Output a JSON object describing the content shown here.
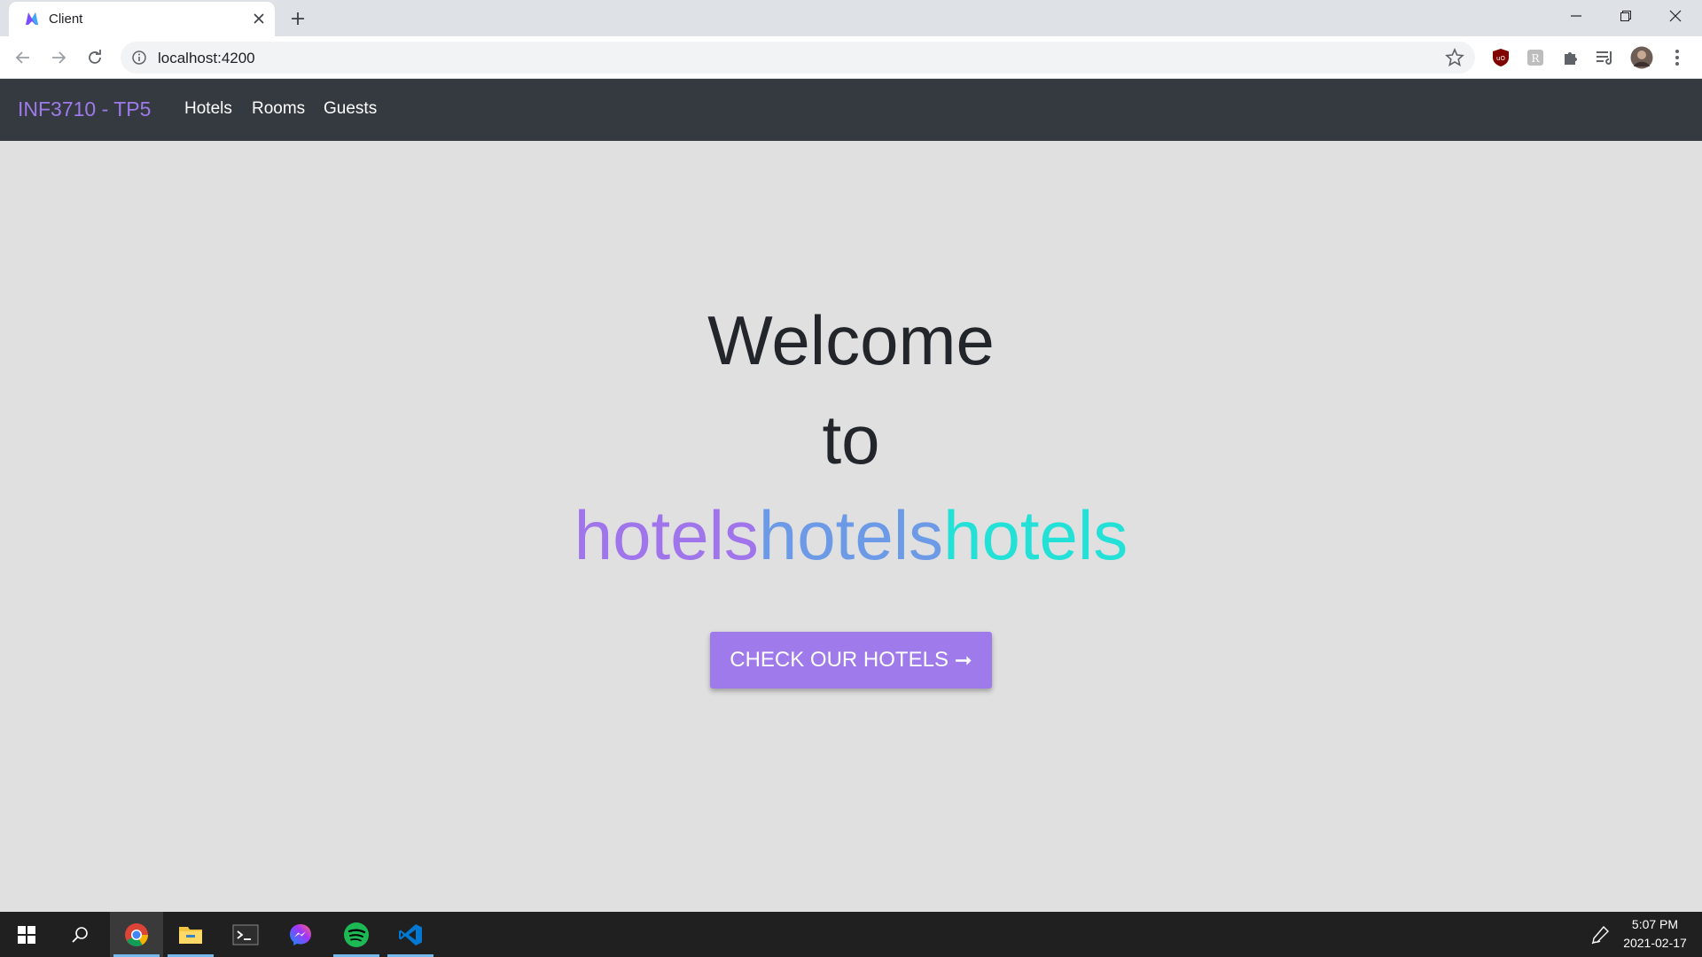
{
  "browser": {
    "tab_title": "Client",
    "url": "localhost:4200"
  },
  "navbar": {
    "brand": "INF3710 - TP5",
    "links": [
      "Hotels",
      "Rooms",
      "Guests"
    ],
    "brand_color": "#9f7aea",
    "background": "#343a40"
  },
  "hero": {
    "line1": "Welcome",
    "line2": "to",
    "brand_parts": [
      "hotels",
      "hotels",
      "hotels"
    ],
    "brand_colors": [
      "#a074ea",
      "#6c9ae6",
      "#23e1d6"
    ],
    "cta_label": "CHECK OUR HOTELS",
    "cta_arrow": "➞"
  },
  "taskbar": {
    "time": "5:07 PM",
    "date": "2021-02-17"
  }
}
